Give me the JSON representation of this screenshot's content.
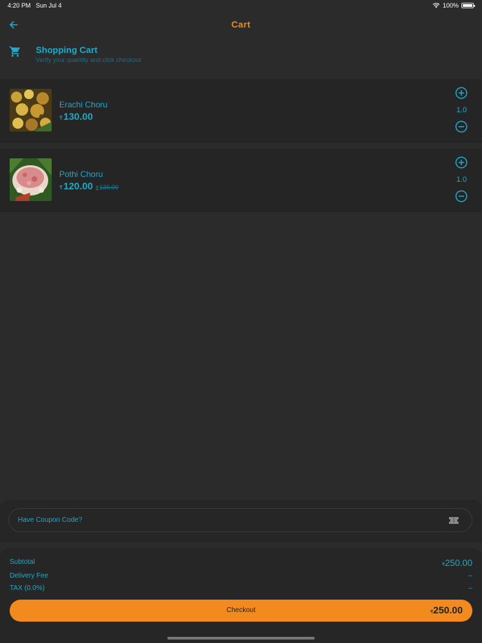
{
  "status": {
    "time": "4:20 PM",
    "date": "Sun Jul 4",
    "battery": "100%"
  },
  "nav": {
    "title": "Cart"
  },
  "header": {
    "title": "Shopping Cart",
    "subtitle": "Verify your quantity and click checkout"
  },
  "currency_symbol": "₹",
  "items": [
    {
      "name": "Erachi Choru",
      "price": "130.00",
      "old_price": "",
      "quantity": "1.0"
    },
    {
      "name": "Pothi Choru",
      "price": "120.00",
      "old_price": "130.00",
      "quantity": "1.0"
    }
  ],
  "coupon": {
    "placeholder": "Have Coupon Code?"
  },
  "summary": {
    "subtotal_label": "Subtotal",
    "subtotal_value": "250.00",
    "delivery_label": "Delivery Fee",
    "delivery_value": "–",
    "tax_label": "TAX (0.0%)",
    "tax_value": "–"
  },
  "checkout": {
    "label": "Checkout",
    "total": "250.00"
  },
  "colors": {
    "accent": "#1fa9c9",
    "brand": "#f28a1d",
    "background": "#2b2b2b"
  },
  "icons": [
    "back-arrow-icon",
    "cart-icon",
    "plus-circle-icon",
    "minus-circle-icon",
    "ticket-icon",
    "wifi-icon",
    "battery-icon"
  ]
}
